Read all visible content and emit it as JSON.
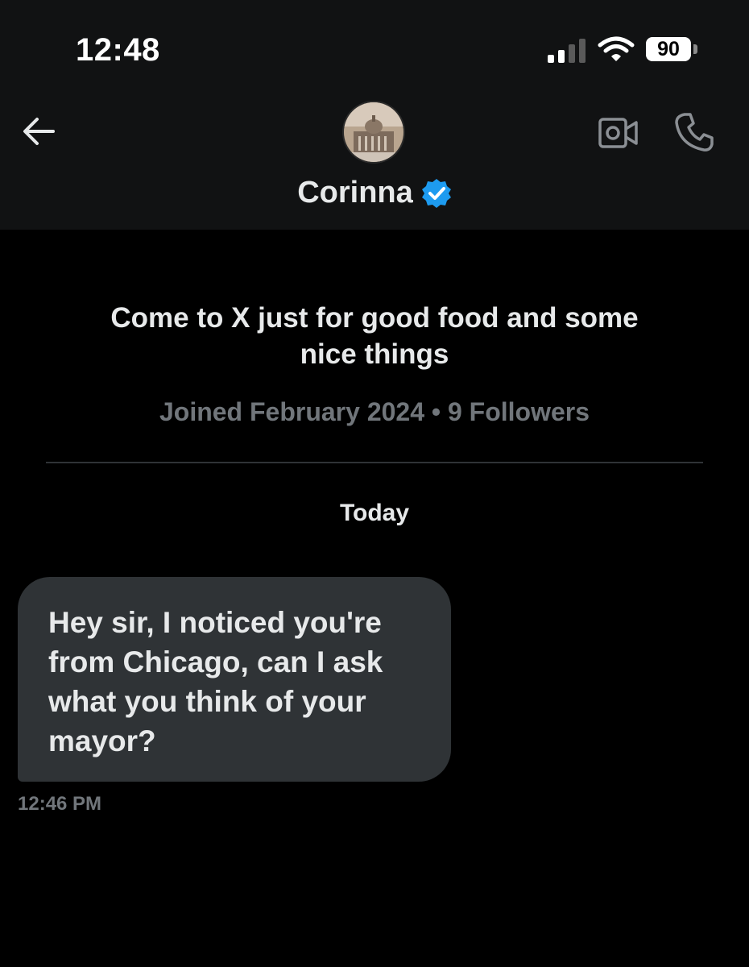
{
  "status_bar": {
    "time": "12:48",
    "battery": "90",
    "icons": [
      "signal-icon",
      "wifi-icon",
      "battery-icon"
    ]
  },
  "header": {
    "back_icon": "arrow-left-icon",
    "avatar_icon": "building-avatar",
    "name": "Corinna",
    "verified_icon": "verified-badge-icon",
    "actions": [
      "video-icon",
      "phone-icon"
    ]
  },
  "profile": {
    "bio": "Come to X just for good food and some nice things",
    "meta": "Joined February 2024 • 9 Followers"
  },
  "conversation": {
    "date_separator": "Today",
    "messages": [
      {
        "text": "Hey sir, I noticed you're from Chicago, can I ask what you think of your mayor?",
        "time": "12:46 PM"
      }
    ]
  },
  "colors": {
    "background": "#000000",
    "header_background": "#111213",
    "bubble": "#2f3336",
    "primary_text": "#e7e9ea",
    "secondary_text": "#71767b",
    "verified_blue": "#1d9bf0"
  }
}
